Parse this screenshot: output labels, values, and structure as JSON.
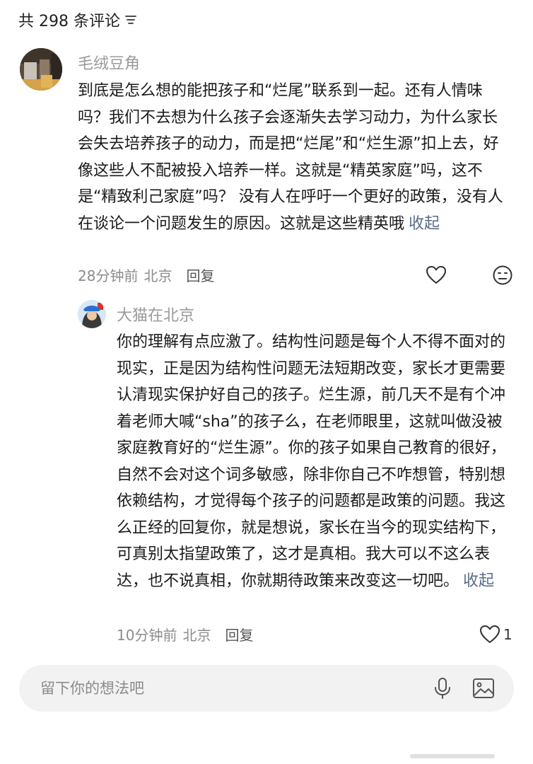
{
  "header": {
    "count_label": "共 298 条评论",
    "sort_icon": "sort-lines-icon"
  },
  "comment": {
    "username": "毛绒豆角",
    "text": "到底是怎么想的能把孩子和“烂尾”联系到一起。还有人情味吗？我们不去想为什么孩子会逐渐失去学习动力，为什么家长会失去培养孩子的动力，而是把“烂尾”和“烂生源”扣上去，好像这些人不配被投入培养一样。这就是“精英家庭”吗，这不是“精致利己家庭”吗？ 没有人在呼吁一个更好的政策，没有人在谈论一个问题发生的原因。这就是这些精英哦",
    "collapse_label": "收起",
    "time": "28分钟前",
    "location": "北京",
    "reply_label": "回复"
  },
  "reply": {
    "username": "大猫在北京",
    "text": "你的理解有点应激了。结构性问题是每个人不得不面对的现实，正是因为结构性问题无法短期改变，家长才更需要认清现实保护好自己的孩子。烂生源，前几天不是有个冲着老师大喊“sha”的孩子么，在老师眼里，这就叫做没被家庭教育好的“烂生源”。你的孩子如果自己教育的很好，自然不会对这个词多敏感，除非你自己不咋想管，特别想依赖结构，才觉得每个孩子的问题都是政策的问题。我这么正经的回复你，就是想说，家长在当今的现实结构下，可真别太指望政策了，这才是真相。我大可以不这么表达，也不说真相，你就期待政策来改变这一切吧。",
    "collapse_label": "收起",
    "time": "10分钟前",
    "location": "北京",
    "reply_label": "回复",
    "like_count": "1"
  },
  "input": {
    "placeholder": "留下你的想法吧"
  },
  "colors": {
    "link": "#5a6b86",
    "meta": "#8c8c8c",
    "username": "#9a9a9a",
    "input_bg": "#f2f2f2"
  }
}
